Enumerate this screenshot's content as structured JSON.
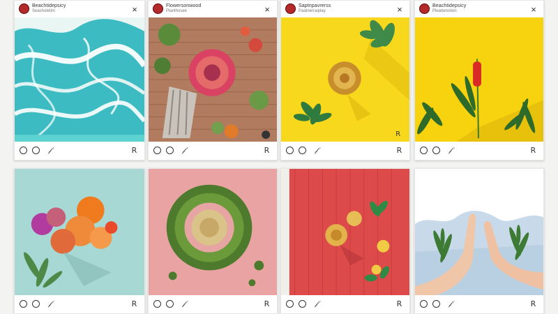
{
  "posts": [
    {
      "username": "Beachtidepsicy",
      "subtitle": "Seasholetim",
      "theme": "ocean",
      "colors": {
        "bg": "#3fc0c4"
      }
    },
    {
      "username": "Flowersonwood",
      "subtitle": "Planthosee",
      "theme": "wood-flowers",
      "colors": {
        "bg": "#b07a5e"
      }
    },
    {
      "username": "Saptnpavrerss",
      "subtitle": "Paatnerraiplay",
      "theme": "yellow-succulent",
      "colors": {
        "bg": "#f7d91e"
      }
    },
    {
      "username": "Beachtidepsicy",
      "subtitle": "Pleattenstion",
      "theme": "yellow-plants",
      "colors": {
        "bg": "#f5d20f"
      }
    },
    {
      "username": "",
      "subtitle": "",
      "theme": "teal-flowers",
      "colors": {
        "bg": "#a8d8d3"
      }
    },
    {
      "username": "",
      "subtitle": "",
      "theme": "pink-wreath",
      "colors": {
        "bg": "#e9a4a4"
      }
    },
    {
      "username": "",
      "subtitle": "",
      "theme": "red-wood-flowers",
      "colors": {
        "bg": "#dd4b4b"
      }
    },
    {
      "username": "",
      "subtitle": "",
      "theme": "hands-sky",
      "colors": {
        "bg": "#c9dbe9"
      }
    }
  ],
  "icons": {
    "close": "×",
    "like": "circle",
    "comment": "circle",
    "share": "𝒻",
    "save": "R"
  }
}
